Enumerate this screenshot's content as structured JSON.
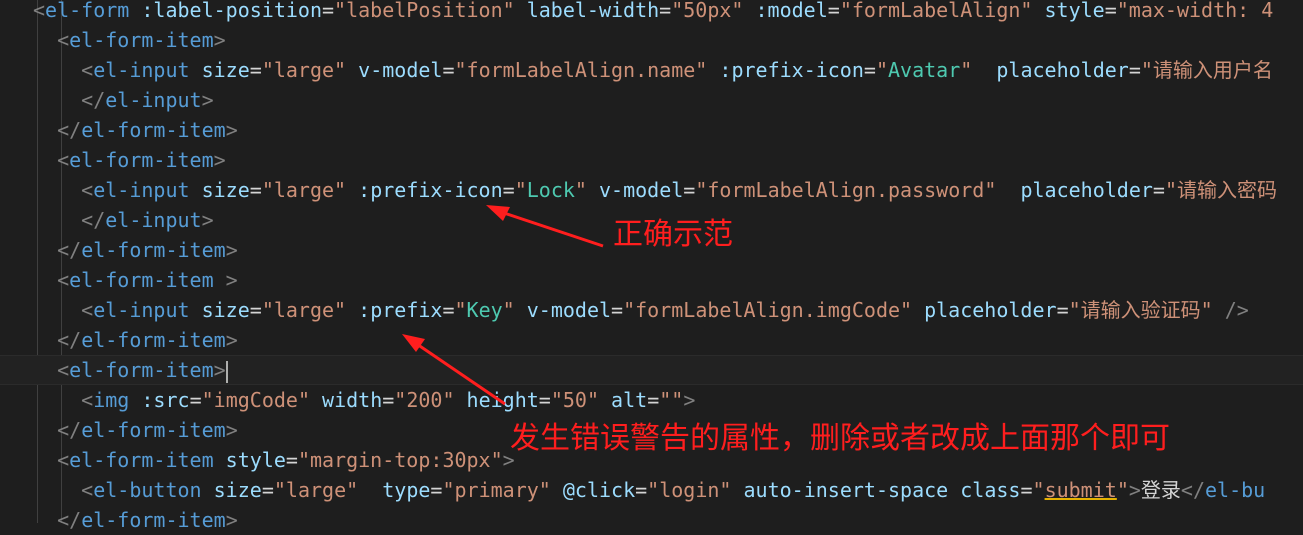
{
  "code_lines": [
    {
      "tokens": [
        {
          "t": "<",
          "c": "punc"
        },
        {
          "t": "el-form",
          "c": "tag"
        },
        {
          "t": " :label-position",
          "c": "attr"
        },
        {
          "t": "=",
          "c": "text"
        },
        {
          "t": "\"labelPosition\"",
          "c": "str"
        },
        {
          "t": " label-width",
          "c": "attr"
        },
        {
          "t": "=",
          "c": "text"
        },
        {
          "t": "\"50px\"",
          "c": "str"
        },
        {
          "t": " :model",
          "c": "attr"
        },
        {
          "t": "=",
          "c": "text"
        },
        {
          "t": "\"formLabelAlign\"",
          "c": "str"
        },
        {
          "t": " style",
          "c": "attr"
        },
        {
          "t": "=",
          "c": "text"
        },
        {
          "t": "\"max-width: 4",
          "c": "str"
        }
      ]
    },
    {
      "tokens": [
        {
          "t": "  ",
          "c": "text"
        },
        {
          "t": "<",
          "c": "punc"
        },
        {
          "t": "el-form-item",
          "c": "tag"
        },
        {
          "t": ">",
          "c": "punc"
        }
      ]
    },
    {
      "tokens": [
        {
          "t": "    ",
          "c": "text"
        },
        {
          "t": "<",
          "c": "punc"
        },
        {
          "t": "el-input",
          "c": "tag"
        },
        {
          "t": " size",
          "c": "attr"
        },
        {
          "t": "=",
          "c": "text"
        },
        {
          "t": "\"large\"",
          "c": "str"
        },
        {
          "t": " v-model",
          "c": "attr"
        },
        {
          "t": "=",
          "c": "text"
        },
        {
          "t": "\"formLabelAlign.name\"",
          "c": "str"
        },
        {
          "t": " :prefix-icon",
          "c": "attr"
        },
        {
          "t": "=",
          "c": "text"
        },
        {
          "t": "\"",
          "c": "str"
        },
        {
          "t": "Avatar",
          "c": "green"
        },
        {
          "t": "\"",
          "c": "str"
        },
        {
          "t": "  placeholder",
          "c": "attr"
        },
        {
          "t": "=",
          "c": "text"
        },
        {
          "t": "\"请输入用户名",
          "c": "str"
        }
      ]
    },
    {
      "tokens": [
        {
          "t": "    ",
          "c": "text"
        },
        {
          "t": "</",
          "c": "punc"
        },
        {
          "t": "el-input",
          "c": "tag"
        },
        {
          "t": ">",
          "c": "punc"
        }
      ]
    },
    {
      "tokens": [
        {
          "t": "  ",
          "c": "text"
        },
        {
          "t": "</",
          "c": "punc"
        },
        {
          "t": "el-form-item",
          "c": "tag"
        },
        {
          "t": ">",
          "c": "punc"
        }
      ]
    },
    {
      "tokens": [
        {
          "t": "  ",
          "c": "text"
        },
        {
          "t": "<",
          "c": "punc"
        },
        {
          "t": "el-form-item",
          "c": "tag"
        },
        {
          "t": ">",
          "c": "punc"
        }
      ]
    },
    {
      "tokens": [
        {
          "t": "    ",
          "c": "text"
        },
        {
          "t": "<",
          "c": "punc"
        },
        {
          "t": "el-input",
          "c": "tag"
        },
        {
          "t": " size",
          "c": "attr"
        },
        {
          "t": "=",
          "c": "text"
        },
        {
          "t": "\"large\"",
          "c": "str"
        },
        {
          "t": " :prefix-icon",
          "c": "attr"
        },
        {
          "t": "=",
          "c": "text"
        },
        {
          "t": "\"",
          "c": "str"
        },
        {
          "t": "Lock",
          "c": "green"
        },
        {
          "t": "\"",
          "c": "str"
        },
        {
          "t": " v-model",
          "c": "attr"
        },
        {
          "t": "=",
          "c": "text"
        },
        {
          "t": "\"formLabelAlign.password\"",
          "c": "str"
        },
        {
          "t": "  placeholder",
          "c": "attr"
        },
        {
          "t": "=",
          "c": "text"
        },
        {
          "t": "\"请输入密码",
          "c": "str"
        }
      ]
    },
    {
      "tokens": [
        {
          "t": "    ",
          "c": "text"
        },
        {
          "t": "</",
          "c": "punc"
        },
        {
          "t": "el-input",
          "c": "tag"
        },
        {
          "t": ">",
          "c": "punc"
        }
      ]
    },
    {
      "tokens": [
        {
          "t": "  ",
          "c": "text"
        },
        {
          "t": "</",
          "c": "punc"
        },
        {
          "t": "el-form-item",
          "c": "tag"
        },
        {
          "t": ">",
          "c": "punc"
        }
      ]
    },
    {
      "tokens": [
        {
          "t": "  ",
          "c": "text"
        },
        {
          "t": "<",
          "c": "punc"
        },
        {
          "t": "el-form-item",
          "c": "tag"
        },
        {
          "t": " >",
          "c": "punc"
        }
      ]
    },
    {
      "tokens": [
        {
          "t": "    ",
          "c": "text"
        },
        {
          "t": "<",
          "c": "punc"
        },
        {
          "t": "el-input",
          "c": "tag"
        },
        {
          "t": " size",
          "c": "attr"
        },
        {
          "t": "=",
          "c": "text"
        },
        {
          "t": "\"large\"",
          "c": "str"
        },
        {
          "t": " :prefix",
          "c": "attr"
        },
        {
          "t": "=",
          "c": "text"
        },
        {
          "t": "\"",
          "c": "str"
        },
        {
          "t": "Key",
          "c": "green"
        },
        {
          "t": "\"",
          "c": "str"
        },
        {
          "t": " v-model",
          "c": "attr"
        },
        {
          "t": "=",
          "c": "text"
        },
        {
          "t": "\"formLabelAlign.imgCode\"",
          "c": "str"
        },
        {
          "t": " placeholder",
          "c": "attr"
        },
        {
          "t": "=",
          "c": "text"
        },
        {
          "t": "\"请输入验证码\"",
          "c": "str"
        },
        {
          "t": " />",
          "c": "punc"
        }
      ]
    },
    {
      "tokens": [
        {
          "t": "  ",
          "c": "text"
        },
        {
          "t": "</",
          "c": "punc"
        },
        {
          "t": "el-form-item",
          "c": "tag"
        },
        {
          "t": ">",
          "c": "punc"
        }
      ]
    },
    {
      "highlight": true,
      "tokens": [
        {
          "t": "  ",
          "c": "text"
        },
        {
          "t": "<",
          "c": "punc"
        },
        {
          "t": "el-form-item",
          "c": "tag"
        },
        {
          "t": ">",
          "c": "punc"
        },
        {
          "t": "",
          "c": "cursor"
        }
      ]
    },
    {
      "tokens": [
        {
          "t": "    ",
          "c": "text"
        },
        {
          "t": "<",
          "c": "punc"
        },
        {
          "t": "img",
          "c": "tag"
        },
        {
          "t": " :src",
          "c": "attr"
        },
        {
          "t": "=",
          "c": "text"
        },
        {
          "t": "\"imgCode\"",
          "c": "str"
        },
        {
          "t": " width",
          "c": "attr"
        },
        {
          "t": "=",
          "c": "text"
        },
        {
          "t": "\"200\"",
          "c": "str"
        },
        {
          "t": " height",
          "c": "attr"
        },
        {
          "t": "=",
          "c": "text"
        },
        {
          "t": "\"50\"",
          "c": "str"
        },
        {
          "t": " alt",
          "c": "attr"
        },
        {
          "t": "=",
          "c": "text"
        },
        {
          "t": "\"\"",
          "c": "str"
        },
        {
          "t": ">",
          "c": "punc"
        }
      ]
    },
    {
      "tokens": [
        {
          "t": "  ",
          "c": "text"
        },
        {
          "t": "</",
          "c": "punc"
        },
        {
          "t": "el-form-item",
          "c": "tag"
        },
        {
          "t": ">",
          "c": "punc"
        }
      ]
    },
    {
      "tokens": [
        {
          "t": "  ",
          "c": "text"
        },
        {
          "t": "<",
          "c": "punc"
        },
        {
          "t": "el-form-item",
          "c": "tag"
        },
        {
          "t": " style",
          "c": "attr"
        },
        {
          "t": "=",
          "c": "text"
        },
        {
          "t": "\"margin-top:",
          "c": "str"
        },
        {
          "t": "30px",
          "c": "str"
        },
        {
          "t": "\"",
          "c": "str"
        },
        {
          "t": ">",
          "c": "punc"
        }
      ]
    },
    {
      "tokens": [
        {
          "t": "    ",
          "c": "text"
        },
        {
          "t": "<",
          "c": "punc"
        },
        {
          "t": "el-button",
          "c": "tag"
        },
        {
          "t": " size",
          "c": "attr"
        },
        {
          "t": "=",
          "c": "text"
        },
        {
          "t": "\"large\"",
          "c": "str"
        },
        {
          "t": "  type",
          "c": "attr"
        },
        {
          "t": "=",
          "c": "text"
        },
        {
          "t": "\"primary\"",
          "c": "str"
        },
        {
          "t": " @click",
          "c": "attr"
        },
        {
          "t": "=",
          "c": "text"
        },
        {
          "t": "\"login\"",
          "c": "str"
        },
        {
          "t": " auto-insert-space",
          "c": "attr"
        },
        {
          "t": " class",
          "c": "attr"
        },
        {
          "t": "=",
          "c": "text"
        },
        {
          "t": "\"",
          "c": "str"
        },
        {
          "t": "submit",
          "c": "str-u"
        },
        {
          "t": "\"",
          "c": "str"
        },
        {
          "t": ">",
          "c": "punc"
        },
        {
          "t": "登录",
          "c": "text"
        },
        {
          "t": "</",
          "c": "punc"
        },
        {
          "t": "el-bu",
          "c": "tag"
        }
      ]
    },
    {
      "tokens": [
        {
          "t": "  ",
          "c": "text"
        },
        {
          "t": "</",
          "c": "punc"
        },
        {
          "t": "el-form-item",
          "c": "tag"
        },
        {
          "t": ">",
          "c": "punc"
        }
      ]
    }
  ],
  "annotations": {
    "correct": "正确示范",
    "error": "发生错误警告的属性，删除或者改成上面那个即可"
  },
  "colors": {
    "background": "#1e1e1e",
    "tag": "#569cd6",
    "attr": "#9cdcfe",
    "string": "#ce9178",
    "icon_value": "#4ec9b0",
    "annotation": "#ff1e1e"
  }
}
